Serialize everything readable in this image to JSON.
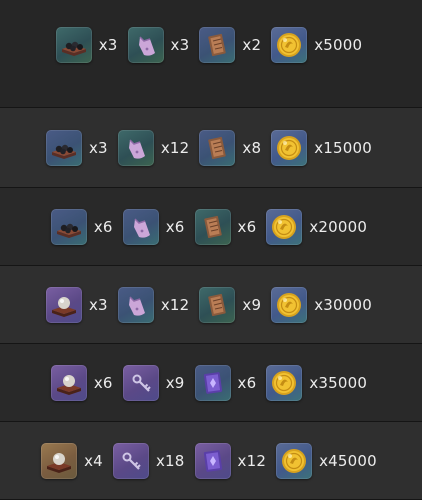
{
  "rows": [
    {
      "items": [
        {
          "icon": "stone-tray-icon",
          "rarity": "green",
          "qty": "x3"
        },
        {
          "icon": "pouch-icon",
          "rarity": "green",
          "qty": "x3"
        },
        {
          "icon": "scroll-icon",
          "rarity": "gray",
          "qty": "x2"
        },
        {
          "icon": "gold-coin-icon",
          "rarity": "coin",
          "qty": "x5000"
        }
      ]
    },
    {
      "items": [
        {
          "icon": "stone-tray-icon",
          "rarity": "blue",
          "qty": "x3"
        },
        {
          "icon": "pouch-icon",
          "rarity": "green",
          "qty": "x12"
        },
        {
          "icon": "scroll-icon",
          "rarity": "gray",
          "qty": "x8"
        },
        {
          "icon": "gold-coin-icon",
          "rarity": "coin",
          "qty": "x15000"
        }
      ]
    },
    {
      "items": [
        {
          "icon": "stone-tray-icon",
          "rarity": "blue",
          "qty": "x6"
        },
        {
          "icon": "pouch-icon",
          "rarity": "blue",
          "qty": "x6"
        },
        {
          "icon": "scroll-icon",
          "rarity": "green",
          "qty": "x6"
        },
        {
          "icon": "gold-coin-icon",
          "rarity": "coin",
          "qty": "x20000"
        }
      ]
    },
    {
      "items": [
        {
          "icon": "pearl-stand-icon",
          "rarity": "purple",
          "qty": "x3"
        },
        {
          "icon": "pouch-icon",
          "rarity": "blue",
          "qty": "x12"
        },
        {
          "icon": "scroll-icon",
          "rarity": "green",
          "qty": "x9"
        },
        {
          "icon": "gold-coin-icon",
          "rarity": "coin",
          "qty": "x30000"
        }
      ]
    },
    {
      "items": [
        {
          "icon": "pearl-stand-icon",
          "rarity": "purple",
          "qty": "x6"
        },
        {
          "icon": "key-charm-icon",
          "rarity": "purple",
          "qty": "x9"
        },
        {
          "icon": "spellbook-icon",
          "rarity": "blue",
          "qty": "x6"
        },
        {
          "icon": "gold-coin-icon",
          "rarity": "coin",
          "qty": "x35000"
        }
      ]
    },
    {
      "items": [
        {
          "icon": "pearl-stand-icon",
          "rarity": "gold",
          "qty": "x4"
        },
        {
          "icon": "key-charm-icon",
          "rarity": "purple",
          "qty": "x18"
        },
        {
          "icon": "spellbook-icon",
          "rarity": "purple",
          "qty": "x12"
        },
        {
          "icon": "gold-coin-icon",
          "rarity": "coin",
          "qty": "x45000"
        }
      ]
    }
  ]
}
